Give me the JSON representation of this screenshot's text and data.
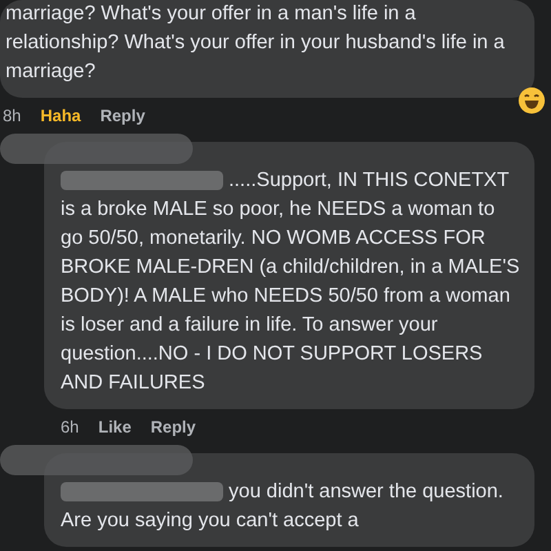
{
  "comments": [
    {
      "redacted_name": false,
      "text": "marriage? What's your offer in a man's life in a relationship? What's your offer in your husband's life in a marriage?",
      "time": "8h",
      "actions": [
        {
          "label": "Haha",
          "active": true
        },
        {
          "label": "Reply",
          "active": false
        }
      ],
      "reaction_emoji": true
    },
    {
      "redacted_name": true,
      "text": ".....Support, IN THIS CONETXT is a broke MALE so poor, he NEEDS a woman to go 50/50, monetarily. NO WOMB ACCESS FOR BROKE MALE-DREN (a child/children, in a MALE'S BODY)! A MALE who NEEDS 50/50 from a woman is loser and a failure in life. To answer your question....NO - I DO NOT SUPPORT LOSERS AND FAILURES",
      "time": "6h",
      "actions": [
        {
          "label": "Like",
          "active": false
        },
        {
          "label": "Reply",
          "active": false
        }
      ],
      "reaction_emoji": false
    },
    {
      "redacted_name": true,
      "text": "you didn't answer the question. Are you saying you can't accept a",
      "reaction_emoji": false
    }
  ]
}
